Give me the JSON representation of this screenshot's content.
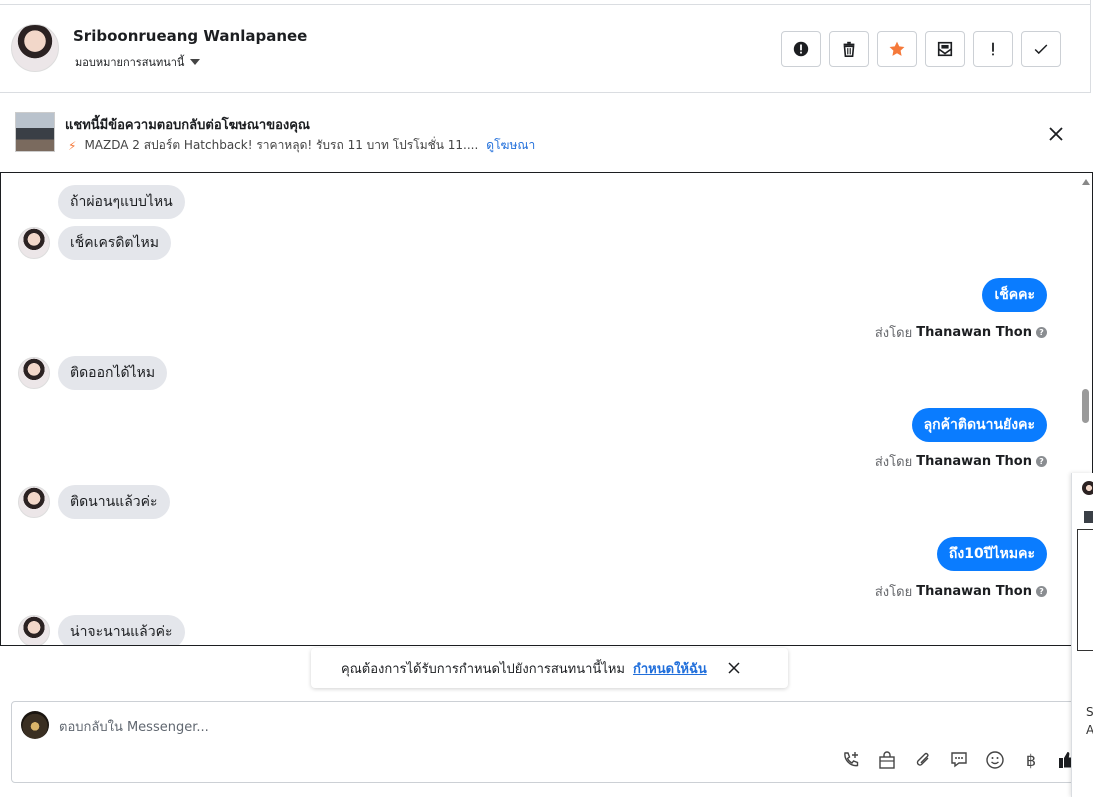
{
  "header": {
    "name": "Sriboonrueang Wanlapanee",
    "assign_label": "มอบหมายการสนทนานี้",
    "tools": [
      "alert-icon",
      "trash-icon",
      "star-icon",
      "mail-icon",
      "exclamation-icon",
      "check-icon"
    ]
  },
  "ad_banner": {
    "title": "แชทนี้มีข้อความตอบกลับต่อโฆษณาของคุณ",
    "ad_text": "MAZDA 2 สปอร์ต Hatchback! ราคาหลุด! รับรถ 11 บาท โปรโมชั่น 11....",
    "view_ad": "ดูโฆษณา"
  },
  "messages": [
    {
      "dir": "in",
      "text": "ถ้าผ่อนๆแบบไหน"
    },
    {
      "dir": "in",
      "text": "เช็คเครดิตไหม"
    },
    {
      "dir": "out",
      "text": "เช็คคะ"
    },
    {
      "dir": "in",
      "text": "ติดออกได้ไหม"
    },
    {
      "dir": "out",
      "text": "ลุกค้าติดนานยังคะ"
    },
    {
      "dir": "in",
      "text": "ติดนานแล้วค่ะ"
    },
    {
      "dir": "out",
      "text": "ถึง10ปีไหมคะ"
    },
    {
      "dir": "in",
      "text": "น่าจะนานแล้วค่ะ"
    }
  ],
  "sent_by": {
    "prefix": "ส่งโดย",
    "agent": "Thanawan Thon"
  },
  "toast": {
    "text": "คุณต้องการได้รับการกำหนดไปยังการสนทนานี้ไหม",
    "action": "กำหนดให้ฉัน"
  },
  "composer": {
    "placeholder": "ตอบกลับใน Messenger..."
  },
  "side_panel": {
    "text_s": "S",
    "text_a": "A"
  }
}
